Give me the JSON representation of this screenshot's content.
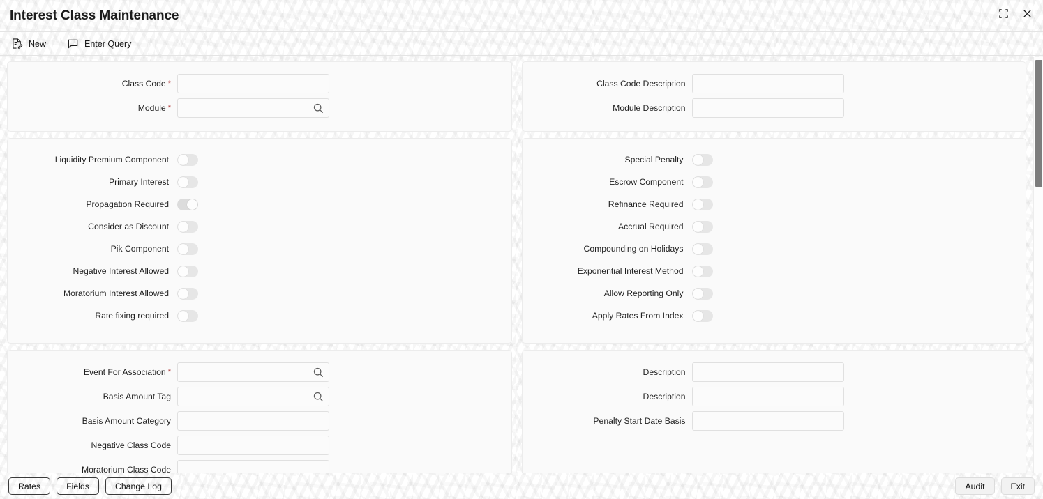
{
  "window": {
    "title": "Interest Class Maintenance",
    "restore_icon": "restore-icon",
    "close_icon": "close-icon"
  },
  "toolbar": {
    "items": [
      {
        "label": "New",
        "icon": "new-document-icon"
      },
      {
        "label": "Enter Query",
        "icon": "speech-bubble-icon"
      }
    ]
  },
  "sections": {
    "identification": {
      "left_fields": [
        {
          "label": "Class Code",
          "value": "",
          "required": true,
          "lov": false
        },
        {
          "label": "Module",
          "value": "",
          "required": true,
          "lov": true
        }
      ],
      "right_fields": [
        {
          "label": "Class Code Description",
          "value": "",
          "required": false,
          "lov": false
        },
        {
          "label": "Module Description",
          "value": "",
          "required": false,
          "lov": false
        }
      ]
    },
    "preferences": {
      "left_toggles": [
        {
          "label": "Liquidity Premium Component",
          "on": false
        },
        {
          "label": "Primary Interest",
          "on": false
        },
        {
          "label": "Propagation Required",
          "on": true
        },
        {
          "label": "Consider as Discount",
          "on": false
        },
        {
          "label": "Pik Component",
          "on": false
        },
        {
          "label": "Negative Interest Allowed",
          "on": false
        },
        {
          "label": "Moratorium Interest Allowed",
          "on": false
        },
        {
          "label": "Rate fixing required",
          "on": false
        }
      ],
      "right_toggles": [
        {
          "label": "Special Penalty",
          "on": false
        },
        {
          "label": "Escrow Component",
          "on": false
        },
        {
          "label": "Refinance Required",
          "on": false
        },
        {
          "label": "Accrual Required",
          "on": false
        },
        {
          "label": "Compounding on Holidays",
          "on": false
        },
        {
          "label": "Exponential Interest Method",
          "on": false
        },
        {
          "label": "Allow Reporting Only",
          "on": false
        },
        {
          "label": "Apply Rates From Index",
          "on": false
        }
      ]
    },
    "association": {
      "left_fields": [
        {
          "label": "Event For Association",
          "value": "",
          "required": true,
          "lov": true
        },
        {
          "label": "Basis Amount Tag",
          "value": "",
          "required": false,
          "lov": true
        },
        {
          "label": "Basis Amount Category",
          "value": "",
          "required": false,
          "lov": false
        },
        {
          "label": "Negative Class Code",
          "value": "",
          "required": false,
          "lov": false
        },
        {
          "label": "Moratorium Class Code",
          "value": "",
          "required": false,
          "lov": false
        }
      ],
      "right_fields": [
        {
          "label": "Description",
          "value": "",
          "required": false,
          "lov": false
        },
        {
          "label": "Description",
          "value": "",
          "required": false,
          "lov": false
        },
        {
          "label": "Penalty Start Date Basis",
          "value": "",
          "required": false,
          "lov": false
        }
      ]
    }
  },
  "footer": {
    "left_buttons": [
      {
        "label": "Rates"
      },
      {
        "label": "Fields"
      },
      {
        "label": "Change Log"
      }
    ],
    "right_buttons": [
      {
        "label": "Audit"
      },
      {
        "label": "Exit"
      }
    ]
  }
}
